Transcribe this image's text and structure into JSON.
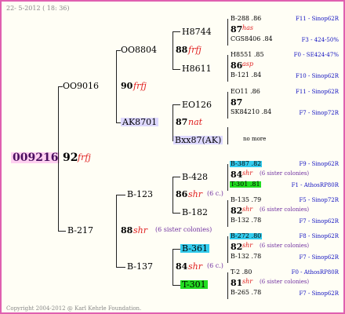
{
  "header": {
    "date": "22- 5-2012 ( 18: 36)"
  },
  "footer": {
    "copyright": "Copyright 2004-2012 @ Karl Kehrle Foundation."
  },
  "root": {
    "id": "009216",
    "year": "92",
    "name": "frfj"
  },
  "gen1": {
    "top": {
      "id": "OO9016"
    },
    "bottom": {
      "id": "B-217"
    }
  },
  "gen2": {
    "a": {
      "id": "OO8804"
    },
    "a_mid": {
      "year": "90",
      "name": "frfj"
    },
    "b": {
      "id": "AK8701"
    },
    "c": {
      "id": "B-123"
    },
    "c_mid": {
      "year": "88",
      "name": "shr",
      "note": "(6 sister colonies)"
    },
    "d": {
      "id": "B-137"
    }
  },
  "gen3": {
    "a": {
      "id": "H8744"
    },
    "a_mid": {
      "year": "88",
      "name": "frfj"
    },
    "b": {
      "id": "H8611"
    },
    "c": {
      "id": "EO126"
    },
    "c_mid": {
      "year": "87",
      "name": "nat"
    },
    "d": {
      "id": "Bxx87(AK)"
    },
    "e": {
      "id": "B-428"
    },
    "e_mid": {
      "year": "86",
      "name": "shr",
      "note": "(6 c.)"
    },
    "f": {
      "id": "B-182"
    },
    "g": {
      "id": "B-361"
    },
    "g_mid": {
      "year": "84",
      "name": "shr",
      "note": "(6 c.)"
    },
    "h": {
      "id": "T-301"
    }
  },
  "gen4": [
    {
      "top": "B-288 .86",
      "mid_year": "87",
      "mid_name": "has",
      "bottom": "CGS8406 .84",
      "tr": "F11 - Sinop62R",
      "br": "F3 - 424-50%"
    },
    {
      "top": "H8551 .85",
      "mid_year": "86",
      "mid_name": "asp",
      "bottom": "B-121 .84",
      "tr": "F0 - SE424-47%",
      "br": "F10 - Sinop62R"
    },
    {
      "top": "EO11 .86",
      "mid_year": "87",
      "mid_name": "",
      "bottom": "SK84210 .84",
      "tr": "F11 - Sinop62R",
      "br": "F7 - Sinop72R"
    },
    {
      "single": "no more"
    },
    {
      "top": "B-387 .82",
      "mid_year": "84",
      "mid_name": "shr",
      "mid_note": "(6 sister colonies)",
      "bottom": "T-301 .81",
      "tr": "F9 - Sinop62R",
      "br": "F1 - AthosRP80R"
    },
    {
      "top": "B-135 .79",
      "mid_year": "82",
      "mid_name": "shr",
      "mid_note": "(6 sister colonies)",
      "bottom": "B-132 .78",
      "tr": "F5 - Sinop72R",
      "br": "F7 - Sinop62R"
    },
    {
      "top": "B-272 .80",
      "mid_year": "82",
      "mid_name": "shr",
      "mid_note": "(6 sister colonies)",
      "bottom": "B-132 .78",
      "tr": "F8 - Sinop62R",
      "br": "F7 - Sinop62R"
    },
    {
      "top": "T-2 .80",
      "mid_year": "81",
      "mid_name": "shr",
      "mid_note": "(6 sister colonies)",
      "bottom": "B-265 .78",
      "tr": "F0 - AthosRP80R",
      "br": "F7 - Sinop62R"
    }
  ]
}
